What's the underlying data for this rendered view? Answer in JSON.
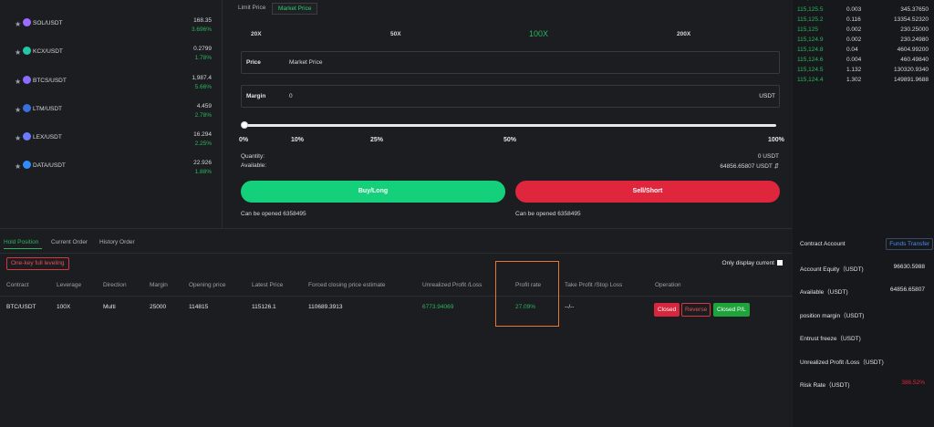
{
  "colors": {
    "green": "#2ab55d",
    "red": "#e0263d",
    "buy": "#15d07a",
    "highlight": "#e8753a"
  },
  "coins": [
    {
      "pair": "SOL/USDT",
      "price": "168.35",
      "change": "3.696%",
      "icon": "sol-icon",
      "color": "#9b6cff"
    },
    {
      "pair": "KCX/USDT",
      "price": "0.2799",
      "change": "1.78%",
      "icon": "kcx-icon",
      "color": "#24c6a8"
    },
    {
      "pair": "BTCS/USDT",
      "price": "1,987.4",
      "change": "5.66%",
      "icon": "btcs-icon",
      "color": "#8a6cff"
    },
    {
      "pair": "LTM/USDT",
      "price": "4.459",
      "change": "2.78%",
      "icon": "ltm-icon",
      "color": "#3a6fe0"
    },
    {
      "pair": "LEX/USDT",
      "price": "16.294",
      "change": "2.25%",
      "icon": "lex-icon",
      "color": "#6c7cff"
    },
    {
      "pair": "DATA/USDT",
      "price": "22.926",
      "change": "1.88%",
      "icon": "data-icon",
      "color": "#2f8cff"
    }
  ],
  "order_tabs": [
    "Limit Price",
    "Market Price"
  ],
  "leverage": [
    "20X",
    "50X",
    "100X",
    "200X"
  ],
  "price_field": {
    "label": "Price",
    "value": "Market Price"
  },
  "margin_field": {
    "label": "Margin",
    "value": "0",
    "unit": "USDT"
  },
  "slider": {
    "value": 0,
    "ticks": [
      "0%",
      "10%",
      "25%",
      "50%",
      "100%"
    ]
  },
  "quantity": {
    "label": "Quantity:",
    "value": "0 USDT"
  },
  "available": {
    "label": "Available:",
    "value": "64856.65807 USDT ⇵"
  },
  "buy_label": "Buy/Long",
  "sell_label": "Sell/Short",
  "can_open_buy": "Can be opened 6358495",
  "can_open_sell": "Can be opened 6358495",
  "orderbook": [
    {
      "price": "115,125.5",
      "qty": "0.003",
      "total": "345.37650"
    },
    {
      "price": "115,125.2",
      "qty": "0.116",
      "total": "13354.52320"
    },
    {
      "price": "115,125",
      "qty": "0.002",
      "total": "230.25000"
    },
    {
      "price": "115,124.9",
      "qty": "0.002",
      "total": "230.24980"
    },
    {
      "price": "115,124.8",
      "qty": "0.04",
      "total": "4604.99200"
    },
    {
      "price": "115,124.6",
      "qty": "0.004",
      "total": "460.49840"
    },
    {
      "price": "115,124.5",
      "qty": "1.132",
      "total": "130320.9340"
    },
    {
      "price": "115,124.4",
      "qty": "1.302",
      "total": "149891.9688"
    }
  ],
  "position_tabs": [
    "Hold Position",
    "Current Order",
    "History Order"
  ],
  "one_key_label": "One-key full leveling",
  "only_display_label": "Only display current",
  "columns": [
    "Contract",
    "Leverage",
    "Direction",
    "Margin",
    "Opening price",
    "Latest Price",
    "Forced closing price estimate",
    "Unrealized Profit /Loss",
    "Profit rate",
    "Take Profit /Stop Loss",
    "Operation"
  ],
  "position_row": {
    "contract": "BTC/USDT",
    "leverage": "100X",
    "direction": "Multi",
    "margin": "25000",
    "opening_price": "114815",
    "latest_price": "115126.1",
    "forced_close": "110689.3913",
    "unrealized": "6773.94069",
    "profit_rate": "27.09%",
    "tpsl": "--/--"
  },
  "operations": {
    "closed": "Closed",
    "reverse": "Reverse",
    "closed_pl": "Closed P/L"
  },
  "account": {
    "title": "Contract Account",
    "funds_transfer": "Funds Transfer",
    "equity_label": "Account Equity（USDT)",
    "equity_value": "96630.5988",
    "available_label": "Available（USDT)",
    "available_value": "64856.65807",
    "position_margin_label": "position margin（USDT)",
    "entrust_label": "Entrust freeze（USDT)",
    "unrealized_label": "Unrealized Profit /Loss（USDT)",
    "risk_label": "Risk Rate（USDT)",
    "risk_value": "386.52%"
  }
}
